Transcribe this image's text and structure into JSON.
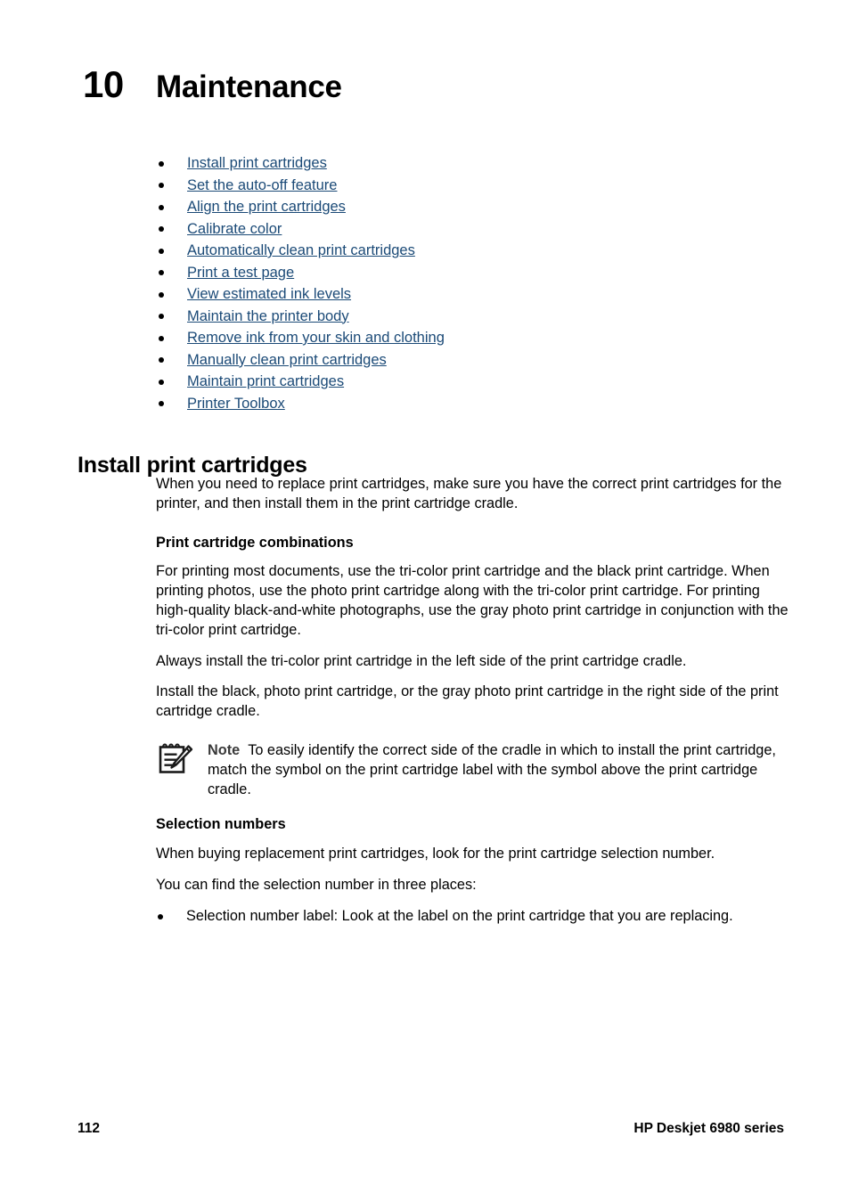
{
  "chapter": {
    "number": "10",
    "title": "Maintenance"
  },
  "toc_links": [
    {
      "label": "Install print cartridges"
    },
    {
      "label": "Set the auto-off feature"
    },
    {
      "label": "Align the print cartridges"
    },
    {
      "label": "Calibrate color"
    },
    {
      "label": "Automatically clean print cartridges"
    },
    {
      "label": "Print a test page"
    },
    {
      "label": "View estimated ink levels"
    },
    {
      "label": "Maintain the printer body"
    },
    {
      "label": "Remove ink from your skin and clothing"
    },
    {
      "label": "Manually clean print cartridges"
    },
    {
      "label": "Maintain print cartridges"
    },
    {
      "label": "Printer Toolbox"
    }
  ],
  "section": {
    "heading": "Install print cartridges",
    "intro": "When you need to replace print cartridges, make sure you have the correct print cartridges for the printer, and then install them in the print cartridge cradle."
  },
  "combinations": {
    "heading": "Print cartridge combinations",
    "para1": "For printing most documents, use the tri-color print cartridge and the black print cartridge. When printing photos, use the photo print cartridge along with the tri-color print cartridge. For printing high-quality black-and-white photographs, use the gray photo print cartridge in conjunction with the tri-color print cartridge.",
    "para2": "Always install the tri-color print cartridge in the left side of the print cartridge cradle.",
    "para3": "Install the black, photo print cartridge, or the gray photo print cartridge in the right side of the print cartridge cradle."
  },
  "note": {
    "icon": "notepad-pencil-icon",
    "label": "Note",
    "text": "To easily identify the correct side of the cradle in which to install the print cartridge, match the symbol on the print cartridge label with the symbol above the print cartridge cradle."
  },
  "selection_numbers": {
    "heading": "Selection numbers",
    "para1": "When buying replacement print cartridges, look for the print cartridge selection number.",
    "para2": "You can find the selection number in three places:",
    "items": [
      {
        "label": "Selection number label: Look at the label on the print cartridge that you are replacing."
      }
    ]
  },
  "footer": {
    "page_number": "112",
    "product": "HP Deskjet 6980 series"
  },
  "colors": {
    "link": "#1b4a77",
    "text": "#000000",
    "note_label": "#3a3a3a",
    "page_background": "#ffffff"
  }
}
